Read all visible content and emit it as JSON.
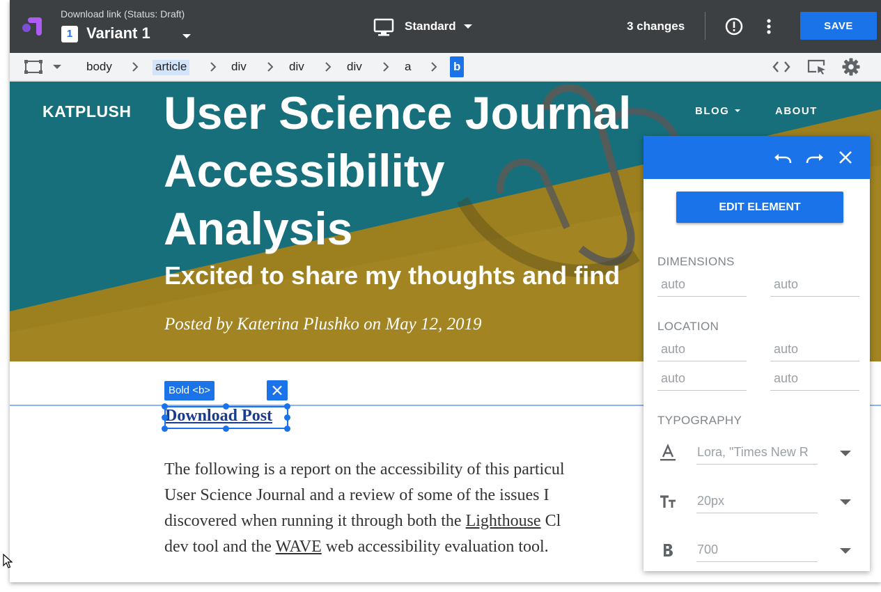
{
  "topbar": {
    "status": "Download link (Status: Draft)",
    "variant_number": "1",
    "variant_name": "Variant 1",
    "device": "Standard",
    "changes": "3 changes",
    "save_label": "SAVE"
  },
  "breadcrumb": {
    "items": [
      "body",
      "article",
      "div",
      "div",
      "div",
      "a",
      "b"
    ],
    "highlighted": "article",
    "active": "b"
  },
  "hero": {
    "site_logo": "KATPLUSH",
    "nav_blog": "BLOG",
    "nav_about": "ABOUT",
    "title_lines": [
      "User Science Journal",
      "Accessibility",
      "Analysis"
    ],
    "subtitle": "Excited to share my thoughts and find",
    "meta": "Posted by Katerina Plushko on May 12, 2019"
  },
  "selection": {
    "chip_label": "Bold <b>",
    "link_text": "Download Post"
  },
  "article": {
    "line1": "The following is a report on the accessibility of this particul",
    "line2": "User Science Journal and a review of some of the issues I",
    "line3_pre": "discovered when running it through both the ",
    "line3_link": "Lighthouse",
    "line3_post": " Cl",
    "line4_pre": "dev tool and the ",
    "line4_link": "WAVE",
    "line4_post": " web accessibility evaluation tool."
  },
  "panel": {
    "edit_label": "EDIT ELEMENT",
    "dimensions_label": "DIMENSIONS",
    "dimensions": [
      "auto",
      "auto"
    ],
    "location_label": "LOCATION",
    "location": [
      "auto",
      "auto",
      "auto",
      "auto"
    ],
    "typography_label": "TYPOGRAPHY",
    "font_family": "Lora, \"Times New R",
    "font_size": "20px",
    "font_weight": "700"
  },
  "colors": {
    "topbar": "#3c4043",
    "accent": "#1a73e8",
    "hero_teal": "#156f7c",
    "hero_gold": "#a2811f"
  },
  "icons": [
    "optimize-logo-icon",
    "caret-down-icon",
    "monitor-icon",
    "alert-circle-icon",
    "more-vert-icon",
    "select-frame-icon",
    "chevron-right-icon",
    "code-icon",
    "inspect-icon",
    "gear-icon",
    "undo-icon",
    "redo-icon",
    "close-icon",
    "font-family-icon",
    "font-size-icon",
    "bold-icon",
    "mouse-cursor-icon"
  ]
}
